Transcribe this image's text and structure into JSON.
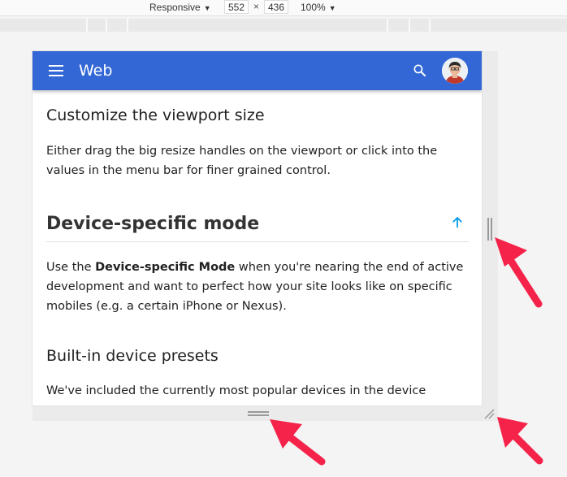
{
  "toolbar": {
    "device_label": "Responsive",
    "width_value": "552",
    "times": "×",
    "height_value": "436",
    "zoom_label": "100%"
  },
  "device": {
    "app_title": "Web",
    "sections": {
      "customize_heading": "Customize the viewport size",
      "customize_text": "Either drag the big resize handles on the viewport or click into the values in the menu bar for finer grained control.",
      "device_mode_heading": "Device-specific mode",
      "device_mode_text_prefix": "Use the ",
      "device_mode_text_bold": "Device-specific Mode",
      "device_mode_text_suffix": " when you're nearing the end of active development and want to perfect how your site looks like on specific mobiles (e.g. a certain iPhone or Nexus).",
      "presets_heading": "Built-in device presets",
      "presets_text": "We've included the currently most popular devices in the device"
    }
  },
  "colors": {
    "appbar": "#3367d6",
    "link_arrow": "#039be5",
    "annotation": "#f5234a"
  }
}
